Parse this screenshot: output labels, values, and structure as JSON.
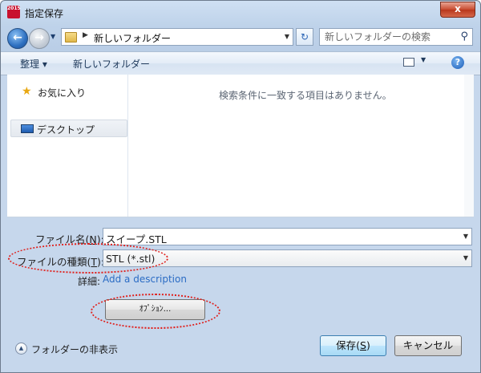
{
  "window": {
    "title": "指定保存",
    "app_icon_text": "2015",
    "close_label": "x"
  },
  "nav": {
    "address_path": "新しいフォルダー",
    "search_placeholder": "新しいフォルダーの検索"
  },
  "toolbar": {
    "organize_label": "整理 ▾",
    "new_folder_label": "新しいフォルダー"
  },
  "navigation_pane": {
    "items": [
      {
        "label": "お気に入り",
        "icon": "star-icon"
      },
      {
        "label": "デスクトップ",
        "icon": "desktop-icon"
      }
    ]
  },
  "content": {
    "empty_message": "検索条件に一致する項目はありません。"
  },
  "form": {
    "filename_label_pre": "ファイル名(",
    "filename_label_key": "N",
    "filename_label_post": "):",
    "filename_value": "スイープ.STL",
    "filetype_label_pre": "ファイルの種類(",
    "filetype_label_key": "T",
    "filetype_label_post": "):",
    "filetype_value": "STL (*.stl)",
    "details_label": "詳細:",
    "description_link": "Add a description",
    "options_button": "ｵﾌﾟｼｮﾝ..."
  },
  "footer": {
    "hide_folders_label": "フォルダーの非表示",
    "save_pre": "保存(",
    "save_key": "S",
    "save_post": ")",
    "cancel_label": "キャンセル"
  },
  "colors": {
    "annotation_ellipse": "#e0201c",
    "link": "#2b6cc4"
  }
}
